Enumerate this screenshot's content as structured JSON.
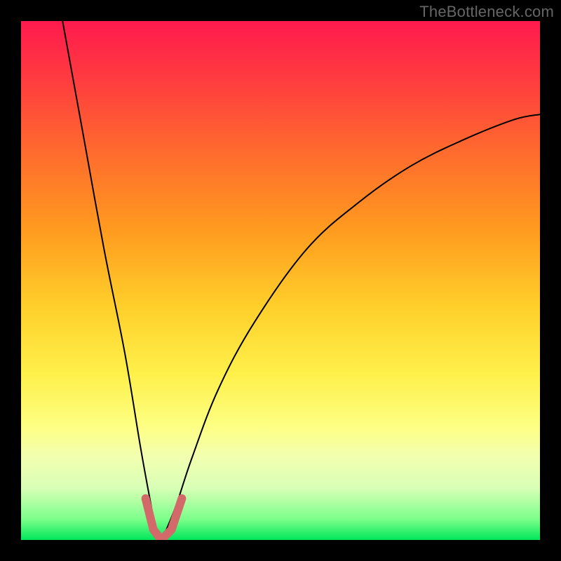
{
  "watermark": "TheBottleneck.com",
  "chart_data": {
    "type": "line",
    "title": "",
    "xlabel": "",
    "ylabel": "",
    "xlim": [
      0,
      100
    ],
    "ylim": [
      0,
      100
    ],
    "grid": false,
    "series": [
      {
        "name": "main-curve",
        "notes": "Single continuous black curve consisting of a steep descending left branch into a narrow valley near x≈27, then an ascending right branch that rises with diminishing slope toward the right edge.",
        "points": [
          {
            "x": 8,
            "y": 100
          },
          {
            "x": 12,
            "y": 78
          },
          {
            "x": 16,
            "y": 56
          },
          {
            "x": 20,
            "y": 36
          },
          {
            "x": 23,
            "y": 18
          },
          {
            "x": 25,
            "y": 7
          },
          {
            "x": 26,
            "y": 2
          },
          {
            "x": 27,
            "y": 0
          },
          {
            "x": 28,
            "y": 2
          },
          {
            "x": 30,
            "y": 7
          },
          {
            "x": 33,
            "y": 16
          },
          {
            "x": 38,
            "y": 29
          },
          {
            "x": 45,
            "y": 42
          },
          {
            "x": 55,
            "y": 56
          },
          {
            "x": 65,
            "y": 65
          },
          {
            "x": 75,
            "y": 72
          },
          {
            "x": 85,
            "y": 77
          },
          {
            "x": 95,
            "y": 81
          },
          {
            "x": 100,
            "y": 82
          }
        ]
      },
      {
        "name": "valley-highlight",
        "notes": "Thick salmon U-shaped stroke emphasizing the valley floor between roughly x≈24–31, y≈0–8.",
        "points": [
          {
            "x": 24,
            "y": 8
          },
          {
            "x": 25.5,
            "y": 2
          },
          {
            "x": 27,
            "y": 0
          },
          {
            "x": 29,
            "y": 2
          },
          {
            "x": 31,
            "y": 8
          }
        ]
      }
    ],
    "colors": {
      "curve": "#000000",
      "highlight": "#d26a6a",
      "gradient_top": "#ff1a4d",
      "gradient_mid": "#ffdf3a",
      "gradient_bottom": "#00e65a",
      "background": "#000000"
    }
  }
}
